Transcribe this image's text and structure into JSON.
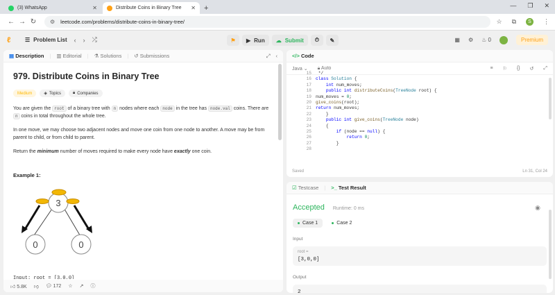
{
  "browser": {
    "tabs": [
      {
        "title": "(3) WhatsApp",
        "color": "#25d366"
      },
      {
        "title": "Distribute Coins in Binary Tree",
        "color": "#ffa116"
      }
    ],
    "url": "leetcode.com/problems/distribute-coins-in-binary-tree/",
    "profile_initial": "S"
  },
  "topbar": {
    "problem_list": "Problem List",
    "run": "Run",
    "submit": "Submit",
    "streak": "0",
    "premium": "Premium"
  },
  "left_tabs": [
    "Description",
    "Editorial",
    "Solutions",
    "Submissions"
  ],
  "problem": {
    "title": "979. Distribute Coins in Binary Tree",
    "tags": [
      "Medium",
      "Topics",
      "Companies"
    ],
    "p1_a": "You are given the ",
    "p1_root": "root",
    "p1_b": " of a binary tree with ",
    "p1_n": "n",
    "p1_c": " nodes where each ",
    "p1_node": "node",
    "p1_d": " in the tree has ",
    "p1_val": "node.val",
    "p1_e": " coins. There are ",
    "p1_n2": "n",
    "p1_f": " coins in total throughout the whole tree.",
    "p2": "In one move, we may choose two adjacent nodes and move one coin from one node to another. A move may be from parent to child, or from child to parent.",
    "p3_a": "Return the ",
    "p3_b": "minimum",
    "p3_c": " number of moves required to make every node have ",
    "p3_d": "exactly",
    "p3_e": " one coin.",
    "example_heading": "Example 1:",
    "tree_nodes": [
      "3",
      "0",
      "0"
    ],
    "input_line": "Input: root = [3,0,0]"
  },
  "footer": {
    "likes": "5.8K",
    "comments": "172"
  },
  "editor": {
    "header": "Code",
    "language": "Java",
    "auto": "Auto",
    "line_numbers": [
      "15",
      "16",
      "17",
      "18",
      "19",
      "20",
      "21",
      "22",
      "23",
      "24",
      "25",
      "26",
      "27",
      "28"
    ],
    "saved": "Saved",
    "cursor": "Ln 31, Col 24"
  },
  "result": {
    "tabs": [
      "Testcase",
      "Test Result"
    ],
    "status": "Accepted",
    "runtime": "Runtime: 0 ms",
    "cases": [
      "Case 1",
      "Case 2"
    ],
    "input_label": "Input",
    "input_key": "root =",
    "input_value": "[3,0,0]",
    "output_label": "Output",
    "output_value": "2"
  }
}
